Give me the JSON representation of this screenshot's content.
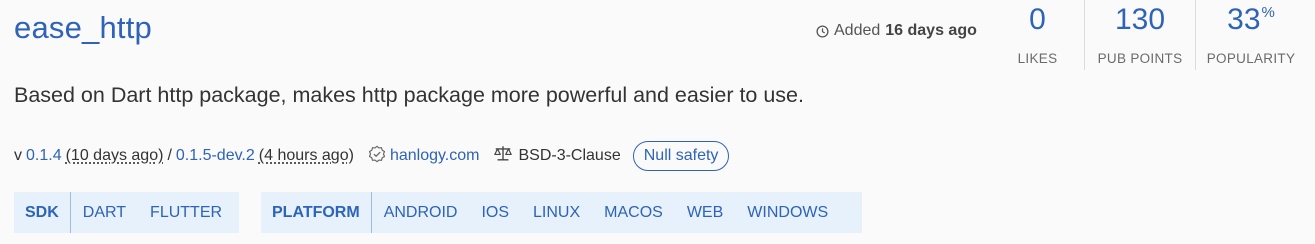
{
  "package": {
    "name": "ease_http",
    "description": "Based on Dart http package, makes http package more powerful and easier to use."
  },
  "added": {
    "prefix": "Added",
    "ago": "16 days ago",
    "icon": "clock-icon"
  },
  "metrics": {
    "likes": {
      "value": "0",
      "label": "LIKES"
    },
    "pub_points": {
      "value": "130",
      "label": "PUB POINTS"
    },
    "popularity": {
      "value": "33",
      "suffix": "%",
      "label": "POPULARITY"
    }
  },
  "meta": {
    "version_prefix": "v",
    "stable_version": "0.1.4",
    "stable_ago": "(10 days ago)",
    "separator": "/",
    "dev_version": "0.1.5-dev.2",
    "dev_ago": "(4 hours ago)",
    "publisher": "hanlogy.com",
    "publisher_icon": "verified-publisher-icon",
    "license": "BSD-3-Clause",
    "license_icon": "scale-icon",
    "null_safety": "Null safety"
  },
  "sdk_tags": {
    "head": "SDK",
    "items": [
      "DART",
      "FLUTTER"
    ]
  },
  "platform_tags": {
    "head": "PLATFORM",
    "items": [
      "ANDROID",
      "IOS",
      "LINUX",
      "MACOS",
      "WEB",
      "WINDOWS"
    ]
  },
  "colors": {
    "link": "#2d63b8",
    "tag_background": "#e6f1fb",
    "page_background": "#fafafa"
  }
}
